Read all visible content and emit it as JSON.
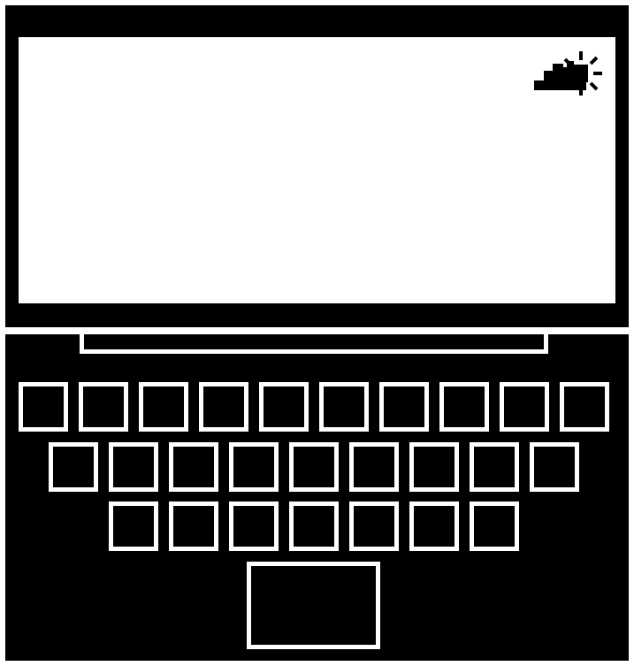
{
  "colors": {
    "frame": "#000000",
    "screen": "#ffffff",
    "key_outline": "#ffffff"
  },
  "screen": {
    "status_icon": "cloud-sun-icon"
  },
  "keyboard": {
    "rows": [
      {
        "keys": 10
      },
      {
        "keys": 9
      },
      {
        "keys": 7
      }
    ]
  },
  "trackpad": {
    "present": true
  }
}
